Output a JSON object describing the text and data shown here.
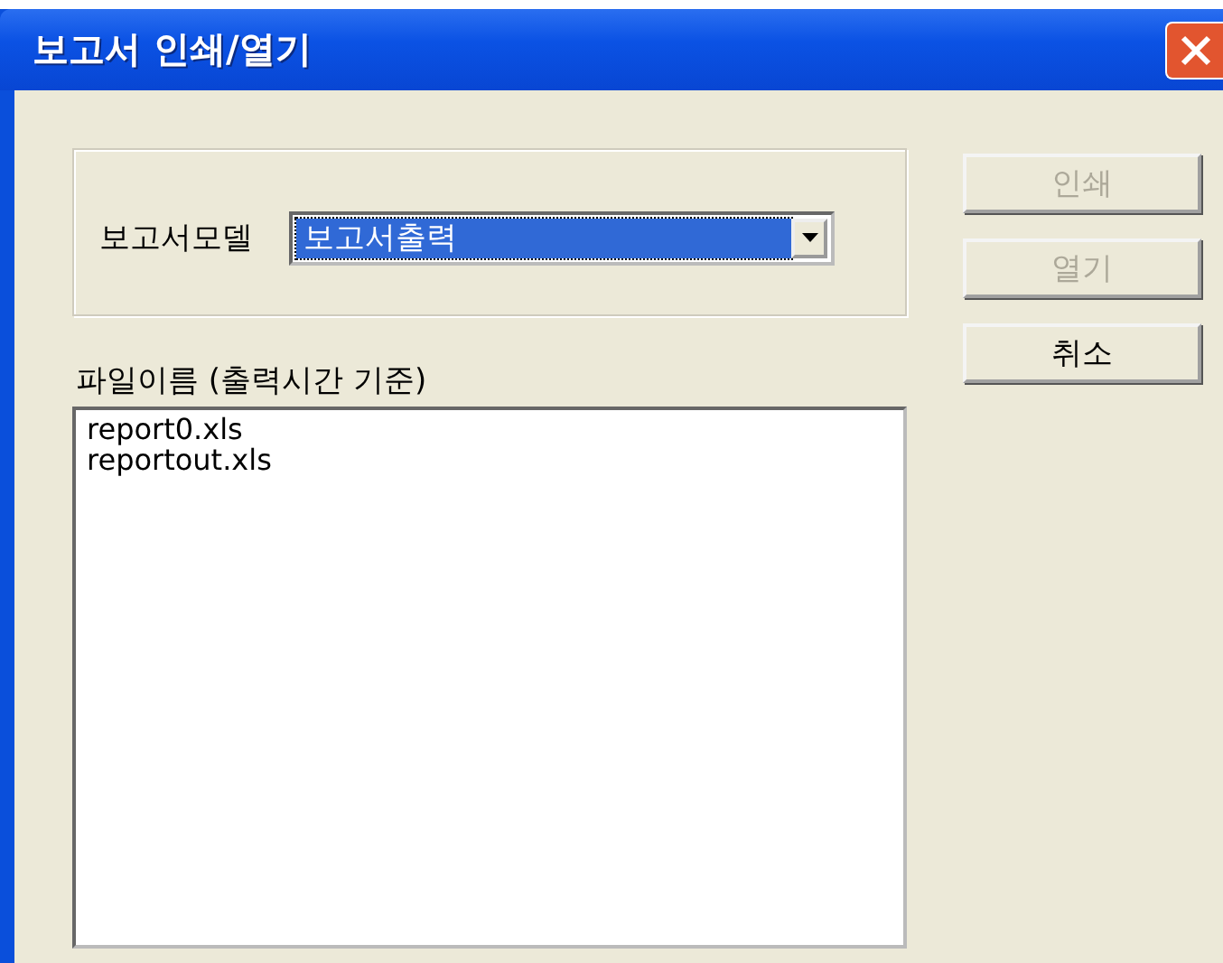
{
  "window": {
    "title": "보고서 인쇄/열기"
  },
  "model": {
    "label": "보고서모델",
    "value": "보고서출력",
    "highlighted": true
  },
  "file_list": {
    "label": "파일이름 (출력시간 기준)",
    "items": [
      {
        "name": "report0.xls"
      },
      {
        "name": "reportout.xls"
      }
    ]
  },
  "buttons": [
    {
      "label": "인쇄",
      "disabled": true
    },
    {
      "label": "열기",
      "disabled": true
    },
    {
      "label": "취소",
      "disabled": false
    }
  ]
}
